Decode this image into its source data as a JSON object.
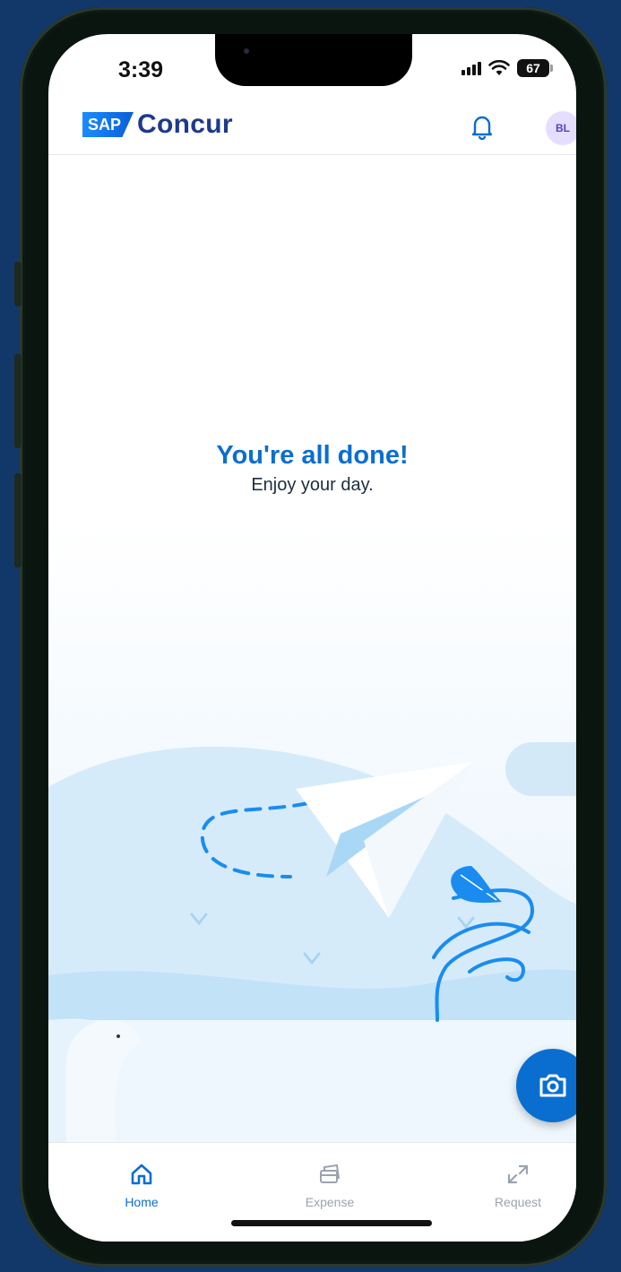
{
  "status_bar": {
    "time": "3:39",
    "battery": "67"
  },
  "header": {
    "brand_badge": "SAP",
    "brand_name": "Concur",
    "avatar_initials": "BL",
    "icon": "bell-icon"
  },
  "main": {
    "title": "You're all done!",
    "subtitle": "Enjoy your day."
  },
  "fab": {
    "icon": "camera-icon"
  },
  "tabs": [
    {
      "label": "Home",
      "icon": "home-icon",
      "active": true
    },
    {
      "label": "Expense",
      "icon": "receipt-icon",
      "active": false
    },
    {
      "label": "Request",
      "icon": "request-icon",
      "active": false
    }
  ],
  "colors": {
    "accent": "#0a6ed1",
    "brand_text": "#1d3a8a",
    "background": "#12386a"
  }
}
